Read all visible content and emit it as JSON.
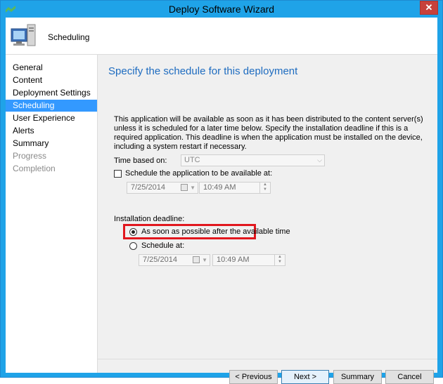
{
  "window": {
    "title": "Deploy Software Wizard",
    "close_glyph": "✕"
  },
  "header": {
    "title": "Scheduling",
    "icon": "computer-icon"
  },
  "nav": {
    "items": [
      {
        "label": "General",
        "state": "normal"
      },
      {
        "label": "Content",
        "state": "normal"
      },
      {
        "label": "Deployment Settings",
        "state": "normal"
      },
      {
        "label": "Scheduling",
        "state": "selected"
      },
      {
        "label": "User Experience",
        "state": "normal"
      },
      {
        "label": "Alerts",
        "state": "normal"
      },
      {
        "label": "Summary",
        "state": "normal"
      },
      {
        "label": "Progress",
        "state": "disabled"
      },
      {
        "label": "Completion",
        "state": "disabled"
      }
    ]
  },
  "main": {
    "title": "Specify the schedule for this deployment",
    "description": "This application will be available as soon as it has been distributed to the content server(s) unless it is scheduled for a later time below. Specify the installation deadline if this is a required application. This deadline is when the application must be installed on the device, including a system restart if necessary.",
    "time_based_label": "Time based on:",
    "time_based_value": "UTC",
    "schedule_available_label": "Schedule the application to be available at:",
    "schedule_available_checked": false,
    "available_date": "7/25/2014",
    "available_time": "10:49 AM",
    "deadline_label": "Installation deadline:",
    "asap_label": "As soon as possible after the available time",
    "asap_selected": true,
    "schedule_at_label": "Schedule at:",
    "schedule_at_selected": false,
    "deadline_date": "7/25/2014",
    "deadline_time": "10:49 AM"
  },
  "buttons": {
    "previous": "< Previous",
    "next": "Next >",
    "summary": "Summary",
    "cancel": "Cancel"
  },
  "colors": {
    "title_bar": "#1fa3e8",
    "selected_nav": "#3399ff",
    "page_title": "#1e6cc0",
    "highlight_box": "#e1171e"
  }
}
